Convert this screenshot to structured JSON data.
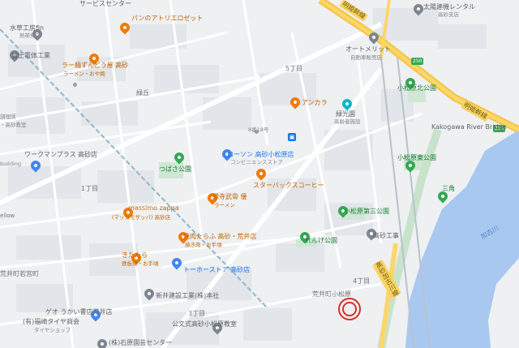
{
  "map": {
    "labels": {
      "sanyo_center": "サービスセンター",
      "bread_atelier": "パンのアトリエロゼット",
      "mizuhara": "水草工房fin",
      "mizuhara_sub": "熱帯魚店",
      "fuji_ind": "富士電体工業",
      "ramen_zundo": "ラー麺ずんどう屋 高砂",
      "ramen_zundo_sub": "ラーメン・おや絢",
      "midorigaoka": "緑丘",
      "kitchen_left": "調理師",
      "kyoshitsu": "・高砂教室",
      "workman": "ワークマンプラス 高砂店",
      "tsubasa_park": "つばさ公園",
      "building_left": "building",
      "yellow_left": "ellow",
      "taiyo_rental": "太陽建機レンタル",
      "taiyo_rental_sub": "高砂支店",
      "meihan_top": "明姫幹線",
      "auto_merit": "オートメリット",
      "auto_merit_sub": "自動車販売店",
      "go_chome": "5丁目",
      "ankara": "アンカラ",
      "ryokoen": "緑光園",
      "ryokoen_sub": "高齢者施設",
      "komatsubara_north": "小松原北公園",
      "meihan_right": "明姫幹線",
      "kakogawa_bridge": "Kakogawa River Bridge",
      "eight": "8番18号",
      "lawson": "ローソン 高砂小松原店",
      "lawson_sub": "コンビニエンスストア",
      "starbucks": "スターバックスコーヒー",
      "komatsubara_east": "小松原東公園",
      "ichome": "1丁目",
      "massimo": "massimo zappa",
      "massimo_sub": "(マッシモザッパ) 高砂店",
      "shirakaba": "縁寺武骨 優",
      "shirakaba_sub": "ラーメン",
      "sankaku": "三角",
      "komatsubara3": "小松原第三公園",
      "kakogawa_river": "加古川",
      "renga_park": "れんげ公園",
      "takasago_kogyo": "高砂工事",
      "yakiniku": "焼肉たらふ 高砂・荒井店",
      "yakiniku_sub": "焼き肉・お手頃",
      "kitatara": "きたたら",
      "kitatara_sub": "鉄板焼・お手頃",
      "tokyo_store": "トーホーストア 高砂店",
      "arai_mae": "荒井町若宮町",
      "yonchome": "4丁目",
      "shinmei": "新井建設工業(株)本社",
      "arai_komatsubara": "荒井町小松原",
      "sanchome": "3丁目",
      "geo": "ゲオ うかい書店荒井店",
      "hirose": "(有)福崎タイヤ商会",
      "hirose_sub": "タイヤショップ",
      "koubun": "公文式高砂小松原教室",
      "ishihara": "(株)石原園芸センター",
      "road_vertical": "高砂加古川線"
    }
  }
}
